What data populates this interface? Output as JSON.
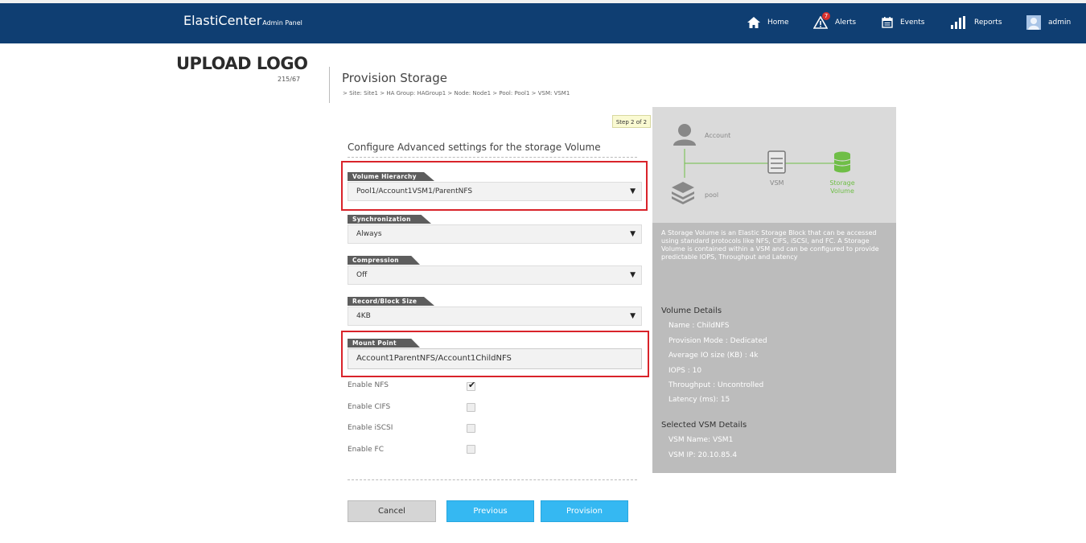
{
  "header": {
    "brand": "ElastiCenter",
    "brand_sub": "Admin Panel",
    "nav": [
      {
        "label": "Home",
        "icon": "home-icon"
      },
      {
        "label": "Alerts",
        "icon": "alert-icon",
        "badge": "7"
      },
      {
        "label": "Events",
        "icon": "calendar-icon"
      },
      {
        "label": "Reports",
        "icon": "bar-chart-icon"
      },
      {
        "label": "admin",
        "icon": "avatar"
      }
    ]
  },
  "logo": {
    "text": "UPLOAD LOGO",
    "size": "215/67"
  },
  "page": {
    "title": "Provision Storage",
    "breadcrumb": "> Site: Site1 > HA Group: HAGroup1 > Node: Node1 > Pool: Pool1 > VSM: VSM1"
  },
  "form": {
    "step": "Step 2 of 2",
    "title": "Configure Advanced settings for the storage Volume",
    "fields": [
      {
        "label": "Volume Hierarchy",
        "value": "Pool1/Account1VSM1/ParentNFS"
      },
      {
        "label": "Synchronization",
        "value": "Always"
      },
      {
        "label": "Compression",
        "value": "Off"
      },
      {
        "label": "Record/Block Size",
        "value": "4KB"
      }
    ],
    "mount_point": {
      "label": "Mount Point",
      "value": "Account1ParentNFS/Account1ChildNFS"
    },
    "checkboxes": [
      {
        "label": "Enable NFS",
        "checked": true
      },
      {
        "label": "Enable CIFS",
        "checked": false
      },
      {
        "label": "Enable iSCSI",
        "checked": false
      },
      {
        "label": "Enable FC",
        "checked": false
      }
    ],
    "buttons": {
      "cancel": "Cancel",
      "previous": "Previous",
      "provision": "Provision"
    }
  },
  "panel": {
    "diagram": {
      "account": "Account",
      "vsm": "VSM",
      "pool": "pool",
      "storage_line1": "Storage",
      "storage_line2": "Volume"
    },
    "description": "A Storage Volume is an Elastic Storage Block that can be accessed using standard protocols like NFS, CIFS, iSCSI, and FC. A Storage Volume is contained within a VSM and can be configured to provide predictable IOPS, Throughput and Latency",
    "volume_details_title": "Volume Details",
    "volume_details": [
      "Name : ChildNFS",
      "Provision Mode : Dedicated",
      "Average IO size (KB) : 4k",
      "IOPS : 10",
      "Throughput : Uncontrolled",
      "Latency (ms): 15"
    ],
    "vsm_details_title": "Selected VSM Details",
    "vsm_details": [
      "VSM Name: VSM1",
      "VSM IP: 20.10.85.4"
    ]
  },
  "colors": {
    "header_bg": "#0f3e72",
    "accent_blue": "#35b8f2",
    "highlight_red": "#d9232a",
    "green": "#6fbe47"
  }
}
